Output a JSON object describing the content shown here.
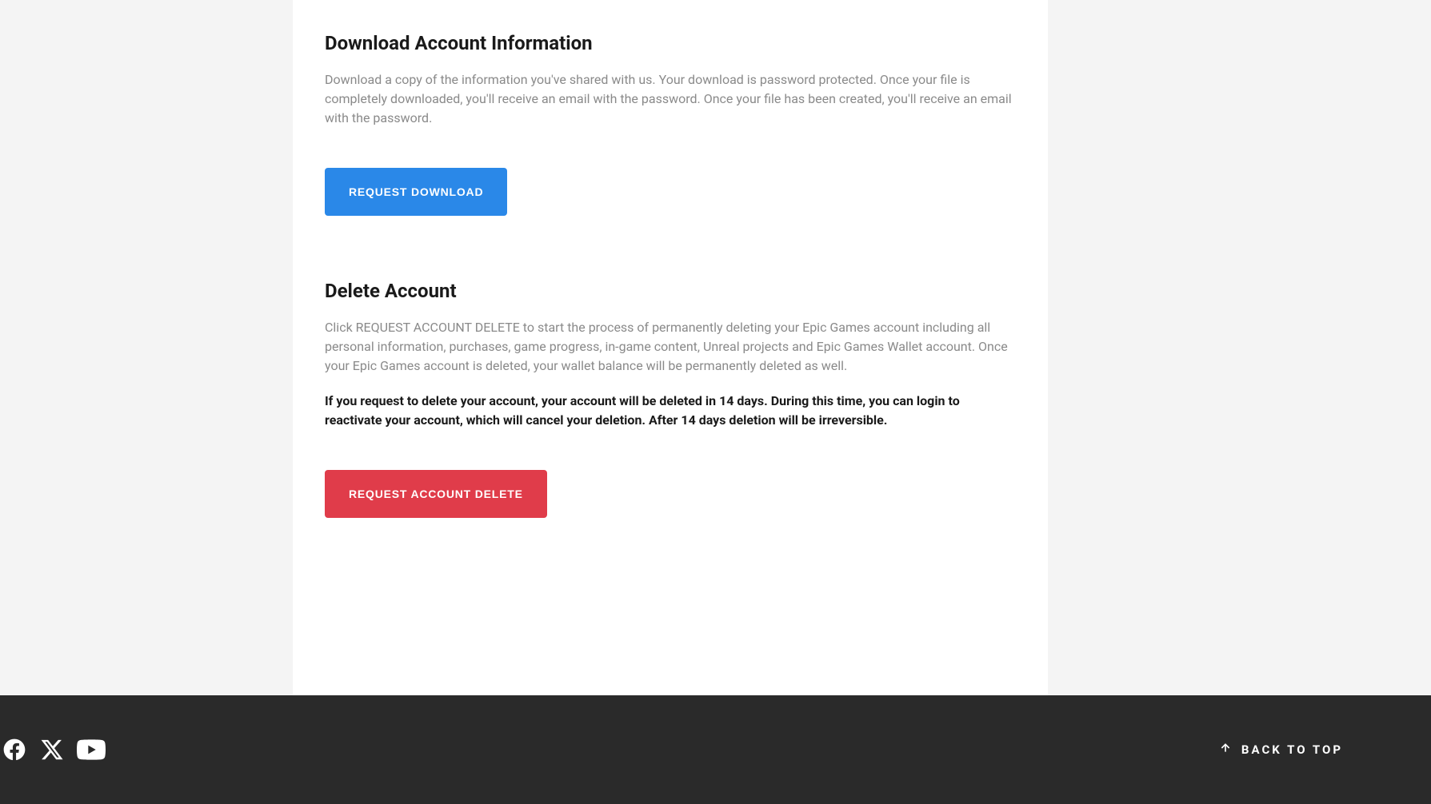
{
  "download_section": {
    "heading": "Download Account Information",
    "description": "Download a copy of the information you've shared with us. Your download is password protected. Once your file is completely downloaded, you'll receive an email with the password. Once your file has been created, you'll receive an email with the password.",
    "button_label": "REQUEST DOWNLOAD"
  },
  "delete_section": {
    "heading": "Delete Account",
    "description": "Click REQUEST ACCOUNT DELETE to start the process of permanently deleting your Epic Games account including all personal information, purchases, game progress, in-game content, Unreal projects and Epic Games Wallet account. Once your Epic Games account is deleted, your wallet balance will be permanently deleted as well.",
    "warning": "If you request to delete your account, your account will be deleted in 14 days. During this time, you can login to reactivate your account, which will cancel your deletion. After 14 days deletion will be irreversible.",
    "button_label": "REQUEST ACCOUNT DELETE"
  },
  "footer": {
    "back_to_top_label": "BACK TO TOP"
  }
}
